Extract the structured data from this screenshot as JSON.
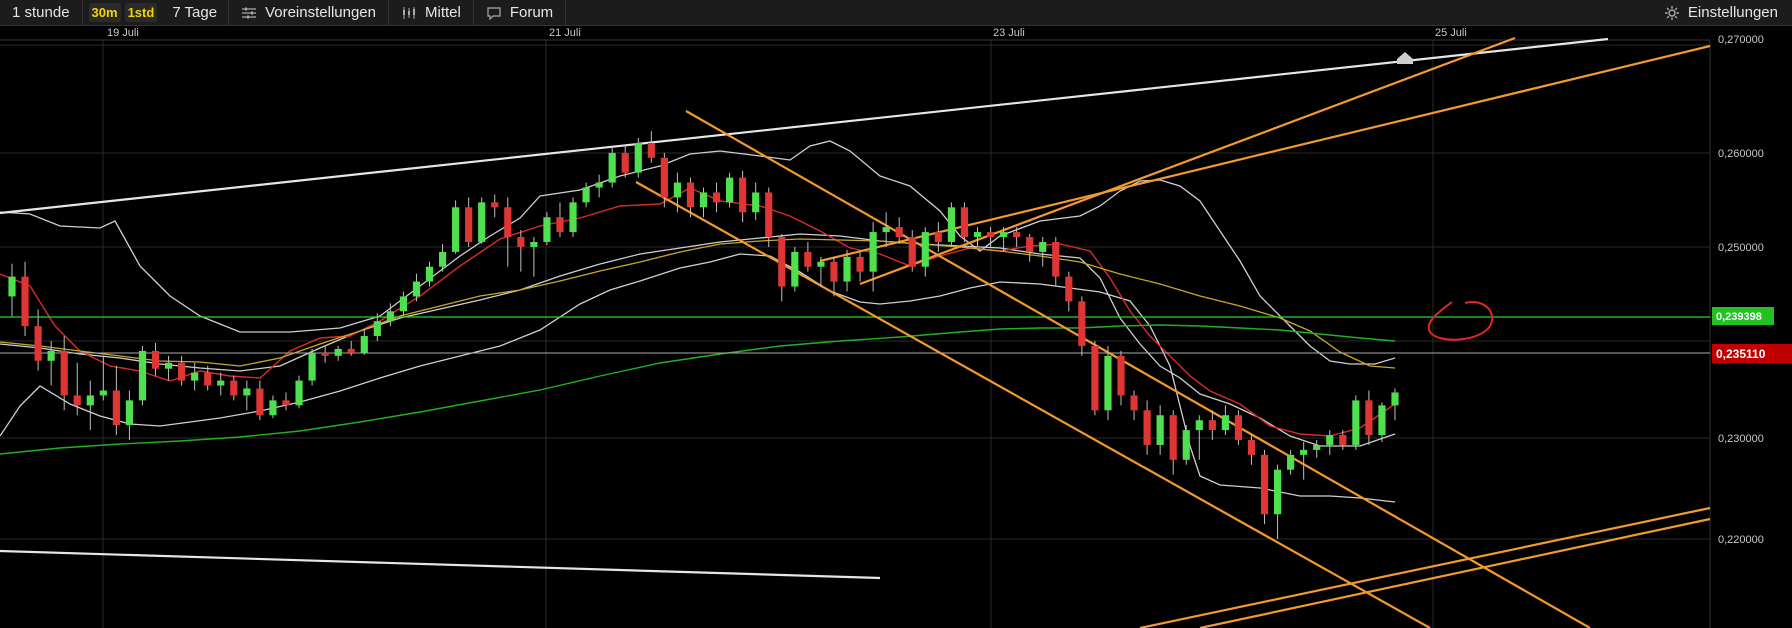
{
  "toolbar": {
    "interval": "1 stunde",
    "range_30m": "30m",
    "range_1std": "1std",
    "range_7d": "7 Tage",
    "presets": "Voreinstellungen",
    "indicator": "Mittel",
    "forum": "Forum",
    "settings": "Einstellungen"
  },
  "chart_data": {
    "type": "candlestick",
    "x_ticks": [
      "19 Juli",
      "21 Juli",
      "23 Juli",
      "25 Juli"
    ],
    "y_ticks": [
      "0,270000",
      "0,260000",
      "0,250000",
      "0,230000",
      "0,220000"
    ],
    "ylim": [
      0.2197,
      0.2715
    ],
    "price_markers": [
      {
        "label": "0,239398",
        "value": 0.239398,
        "color": "#00c000"
      },
      {
        "label": "0,235110",
        "value": 0.23511,
        "color": "#c00000"
      }
    ],
    "candles": [
      [
        0.2445,
        0.2478,
        0.2425,
        0.2465
      ],
      [
        0.2465,
        0.248,
        0.2405,
        0.2415
      ],
      [
        0.2415,
        0.2432,
        0.237,
        0.238
      ],
      [
        0.238,
        0.24,
        0.2355,
        0.239
      ],
      [
        0.239,
        0.2405,
        0.233,
        0.2345
      ],
      [
        0.2345,
        0.2378,
        0.2325,
        0.2335
      ],
      [
        0.2335,
        0.236,
        0.231,
        0.2345
      ],
      [
        0.2345,
        0.2385,
        0.234,
        0.235
      ],
      [
        0.235,
        0.2375,
        0.2305,
        0.2315
      ],
      [
        0.2315,
        0.235,
        0.23,
        0.234
      ],
      [
        0.234,
        0.2395,
        0.2335,
        0.239
      ],
      [
        0.239,
        0.2398,
        0.2365,
        0.2372
      ],
      [
        0.2372,
        0.2385,
        0.236,
        0.2378
      ],
      [
        0.2378,
        0.2385,
        0.2355,
        0.236
      ],
      [
        0.236,
        0.2378,
        0.235,
        0.2368
      ],
      [
        0.2368,
        0.2375,
        0.235,
        0.2355
      ],
      [
        0.2355,
        0.2368,
        0.2345,
        0.236
      ],
      [
        0.236,
        0.2365,
        0.234,
        0.2345
      ],
      [
        0.2345,
        0.236,
        0.233,
        0.2352
      ],
      [
        0.2352,
        0.236,
        0.232,
        0.2325
      ],
      [
        0.2325,
        0.2345,
        0.2322,
        0.234
      ],
      [
        0.234,
        0.2348,
        0.233,
        0.2335
      ],
      [
        0.2335,
        0.2365,
        0.2332,
        0.236
      ],
      [
        0.236,
        0.2392,
        0.2355,
        0.2388
      ],
      [
        0.2388,
        0.2395,
        0.2378,
        0.2385
      ],
      [
        0.2385,
        0.2395,
        0.238,
        0.2392
      ],
      [
        0.2392,
        0.24,
        0.2385,
        0.2388
      ],
      [
        0.2388,
        0.2412,
        0.2386,
        0.2405
      ],
      [
        0.2405,
        0.2428,
        0.24,
        0.242
      ],
      [
        0.242,
        0.2438,
        0.2415,
        0.243
      ],
      [
        0.243,
        0.245,
        0.2425,
        0.2445
      ],
      [
        0.2445,
        0.2468,
        0.244,
        0.246
      ],
      [
        0.246,
        0.248,
        0.2455,
        0.2475
      ],
      [
        0.2475,
        0.2498,
        0.247,
        0.249
      ],
      [
        0.249,
        0.2542,
        0.2488,
        0.2535
      ],
      [
        0.2535,
        0.2545,
        0.2495,
        0.25
      ],
      [
        0.25,
        0.2545,
        0.2498,
        0.254
      ],
      [
        0.254,
        0.2548,
        0.2525,
        0.2535
      ],
      [
        0.2535,
        0.2545,
        0.2475,
        0.2505
      ],
      [
        0.2505,
        0.2512,
        0.247,
        0.2495
      ],
      [
        0.2495,
        0.2505,
        0.2465,
        0.25
      ],
      [
        0.25,
        0.253,
        0.2497,
        0.2525
      ],
      [
        0.2525,
        0.254,
        0.2505,
        0.251
      ],
      [
        0.251,
        0.2545,
        0.2505,
        0.254
      ],
      [
        0.254,
        0.256,
        0.2535,
        0.2555
      ],
      [
        0.2555,
        0.2568,
        0.2545,
        0.256
      ],
      [
        0.256,
        0.2595,
        0.2555,
        0.259
      ],
      [
        0.259,
        0.2598,
        0.2565,
        0.257
      ],
      [
        0.257,
        0.2605,
        0.2565,
        0.26
      ],
      [
        0.26,
        0.2612,
        0.258,
        0.2585
      ],
      [
        0.2585,
        0.259,
        0.2535,
        0.2545
      ],
      [
        0.2545,
        0.257,
        0.253,
        0.256
      ],
      [
        0.256,
        0.2565,
        0.2525,
        0.2535
      ],
      [
        0.2535,
        0.2555,
        0.2525,
        0.255
      ],
      [
        0.255,
        0.256,
        0.253,
        0.254
      ],
      [
        0.254,
        0.257,
        0.2535,
        0.2565
      ],
      [
        0.2565,
        0.2572,
        0.252,
        0.253
      ],
      [
        0.253,
        0.256,
        0.2522,
        0.255
      ],
      [
        0.255,
        0.2555,
        0.2495,
        0.2505
      ],
      [
        0.2505,
        0.2508,
        0.244,
        0.2455
      ],
      [
        0.2455,
        0.2495,
        0.245,
        0.249
      ],
      [
        0.249,
        0.25,
        0.247,
        0.2475
      ],
      [
        0.2475,
        0.2485,
        0.2455,
        0.248
      ],
      [
        0.248,
        0.2485,
        0.2445,
        0.246
      ],
      [
        0.246,
        0.2492,
        0.245,
        0.2485
      ],
      [
        0.2485,
        0.249,
        0.246,
        0.247
      ],
      [
        0.247,
        0.252,
        0.245,
        0.251
      ],
      [
        0.251,
        0.253,
        0.2495,
        0.2515
      ],
      [
        0.2515,
        0.2525,
        0.2498,
        0.2505
      ],
      [
        0.2505,
        0.2512,
        0.247,
        0.2475
      ],
      [
        0.2475,
        0.2515,
        0.2465,
        0.251
      ],
      [
        0.251,
        0.252,
        0.249,
        0.25
      ],
      [
        0.25,
        0.254,
        0.2495,
        0.2535
      ],
      [
        0.2535,
        0.254,
        0.25,
        0.2505
      ],
      [
        0.2505,
        0.2515,
        0.2495,
        0.251
      ],
      [
        0.251,
        0.2515,
        0.2495,
        0.2505
      ],
      [
        0.2505,
        0.2515,
        0.249,
        0.251
      ],
      [
        0.251,
        0.2515,
        0.2495,
        0.2505
      ],
      [
        0.2505,
        0.2508,
        0.248,
        0.249
      ],
      [
        0.249,
        0.2505,
        0.2475,
        0.25
      ],
      [
        0.25,
        0.2505,
        0.2455,
        0.2465
      ],
      [
        0.2465,
        0.247,
        0.243,
        0.244
      ],
      [
        0.244,
        0.2445,
        0.2385,
        0.2395
      ],
      [
        0.2395,
        0.24,
        0.2325,
        0.233
      ],
      [
        0.233,
        0.2395,
        0.232,
        0.2385
      ],
      [
        0.2385,
        0.239,
        0.2335,
        0.2345
      ],
      [
        0.2345,
        0.235,
        0.232,
        0.233
      ],
      [
        0.233,
        0.234,
        0.2285,
        0.2295
      ],
      [
        0.2295,
        0.2335,
        0.2285,
        0.2325
      ],
      [
        0.2325,
        0.233,
        0.2265,
        0.228
      ],
      [
        0.228,
        0.2315,
        0.2275,
        0.231
      ],
      [
        0.231,
        0.2325,
        0.228,
        0.232
      ],
      [
        0.232,
        0.233,
        0.23,
        0.231
      ],
      [
        0.231,
        0.2335,
        0.2305,
        0.2325
      ],
      [
        0.2325,
        0.233,
        0.2295,
        0.23
      ],
      [
        0.23,
        0.2305,
        0.2275,
        0.2285
      ],
      [
        0.2285,
        0.229,
        0.2215,
        0.2225
      ],
      [
        0.2225,
        0.2275,
        0.22,
        0.227
      ],
      [
        0.227,
        0.229,
        0.2265,
        0.2285
      ],
      [
        0.2285,
        0.2298,
        0.226,
        0.229
      ],
      [
        0.229,
        0.23,
        0.2282,
        0.2295
      ],
      [
        0.2295,
        0.231,
        0.2285,
        0.2305
      ],
      [
        0.2305,
        0.231,
        0.229,
        0.2295
      ],
      [
        0.2295,
        0.2345,
        0.229,
        0.234
      ],
      [
        0.234,
        0.235,
        0.2295,
        0.2305
      ],
      [
        0.2305,
        0.2338,
        0.2298,
        0.2335
      ],
      [
        0.2335,
        0.2352,
        0.232,
        0.2348
      ]
    ]
  }
}
